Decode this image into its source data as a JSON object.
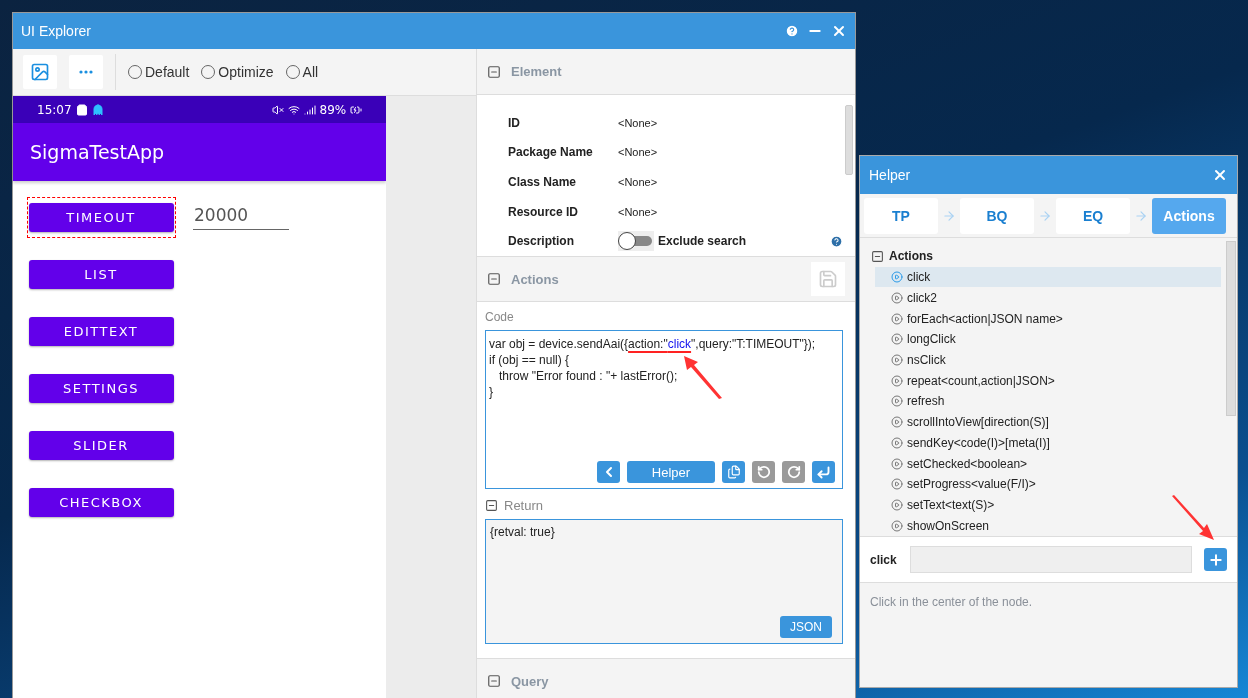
{
  "window": {
    "title": "UI Explorer"
  },
  "toolbar": {
    "radios": [
      {
        "label": "Default",
        "selected": false
      },
      {
        "label": "Optimize",
        "selected": false
      },
      {
        "label": "All",
        "selected": false
      }
    ]
  },
  "phone": {
    "status_bar": {
      "time": "15:07",
      "battery": "89%"
    },
    "app_title": "SigmaTestApp",
    "buttons": [
      {
        "label": "TIMEOUT",
        "selected": true
      },
      {
        "label": "LIST",
        "selected": false
      },
      {
        "label": "EDITTEXT",
        "selected": false
      },
      {
        "label": "SETTINGS",
        "selected": false
      },
      {
        "label": "SLIDER",
        "selected": false
      },
      {
        "label": "CHECKBOX",
        "selected": false
      }
    ],
    "field": {
      "value": "20000"
    }
  },
  "element_panel": {
    "title": "Element",
    "properties": [
      {
        "label": "ID",
        "value": "<None>"
      },
      {
        "label": "Package Name",
        "value": "<None>"
      },
      {
        "label": "Class Name",
        "value": "<None>"
      },
      {
        "label": "Resource ID",
        "value": "<None>"
      }
    ],
    "description": {
      "label": "Description",
      "toggle_label": "Exclude search",
      "on": false
    }
  },
  "actions_panel": {
    "title": "Actions",
    "code_label": "Code",
    "helper_button": "Helper",
    "code_lines": [
      [
        {
          "text": "var obj = device.sendAai({",
          "kind": "plain",
          "marked": false
        },
        {
          "text": "action:\"",
          "kind": "plain",
          "marked": true
        },
        {
          "text": "click",
          "kind": "string",
          "marked": true
        },
        {
          "text": "\",query:\"T:TIMEOUT\"});",
          "kind": "plain",
          "marked": false
        }
      ],
      [
        {
          "text": "if (obj == null) {",
          "kind": "plain",
          "marked": false
        }
      ],
      [
        {
          "text": "   throw \"Error found : \"+ lastError();",
          "kind": "plain",
          "marked": false
        }
      ],
      [
        {
          "text": "}",
          "kind": "plain",
          "marked": false
        }
      ]
    ]
  },
  "return_panel": {
    "title": "Return",
    "value": "{retval: true}",
    "json_button": "JSON"
  },
  "query_panel": {
    "title": "Query"
  },
  "helper": {
    "title": "Helper",
    "steps": [
      {
        "label": "TP",
        "selected": false
      },
      {
        "label": "BQ",
        "selected": false
      },
      {
        "label": "EQ",
        "selected": false
      },
      {
        "label": "Actions",
        "selected": true
      }
    ],
    "tree": {
      "label": "Actions",
      "expanded": true,
      "children": [
        {
          "label": "click",
          "selected": true
        },
        {
          "label": "click2",
          "selected": false
        },
        {
          "label": "forEach<action|JSON name>",
          "selected": false
        },
        {
          "label": "longClick",
          "selected": false
        },
        {
          "label": "nsClick",
          "selected": false
        },
        {
          "label": "repeat<count,action|JSON>",
          "selected": false
        },
        {
          "label": "refresh",
          "selected": false
        },
        {
          "label": "scrollIntoView[direction(S)]",
          "selected": false
        },
        {
          "label": "sendKey<code(I)>[meta(I)]",
          "selected": false
        },
        {
          "label": "setChecked<boolean>",
          "selected": false
        },
        {
          "label": "setProgress<value(F/I)>",
          "selected": false
        },
        {
          "label": "setText<text(S)>",
          "selected": false
        },
        {
          "label": "showOnScreen",
          "selected": false
        }
      ]
    },
    "action_label": "click",
    "description": "Click in the center of the node."
  }
}
